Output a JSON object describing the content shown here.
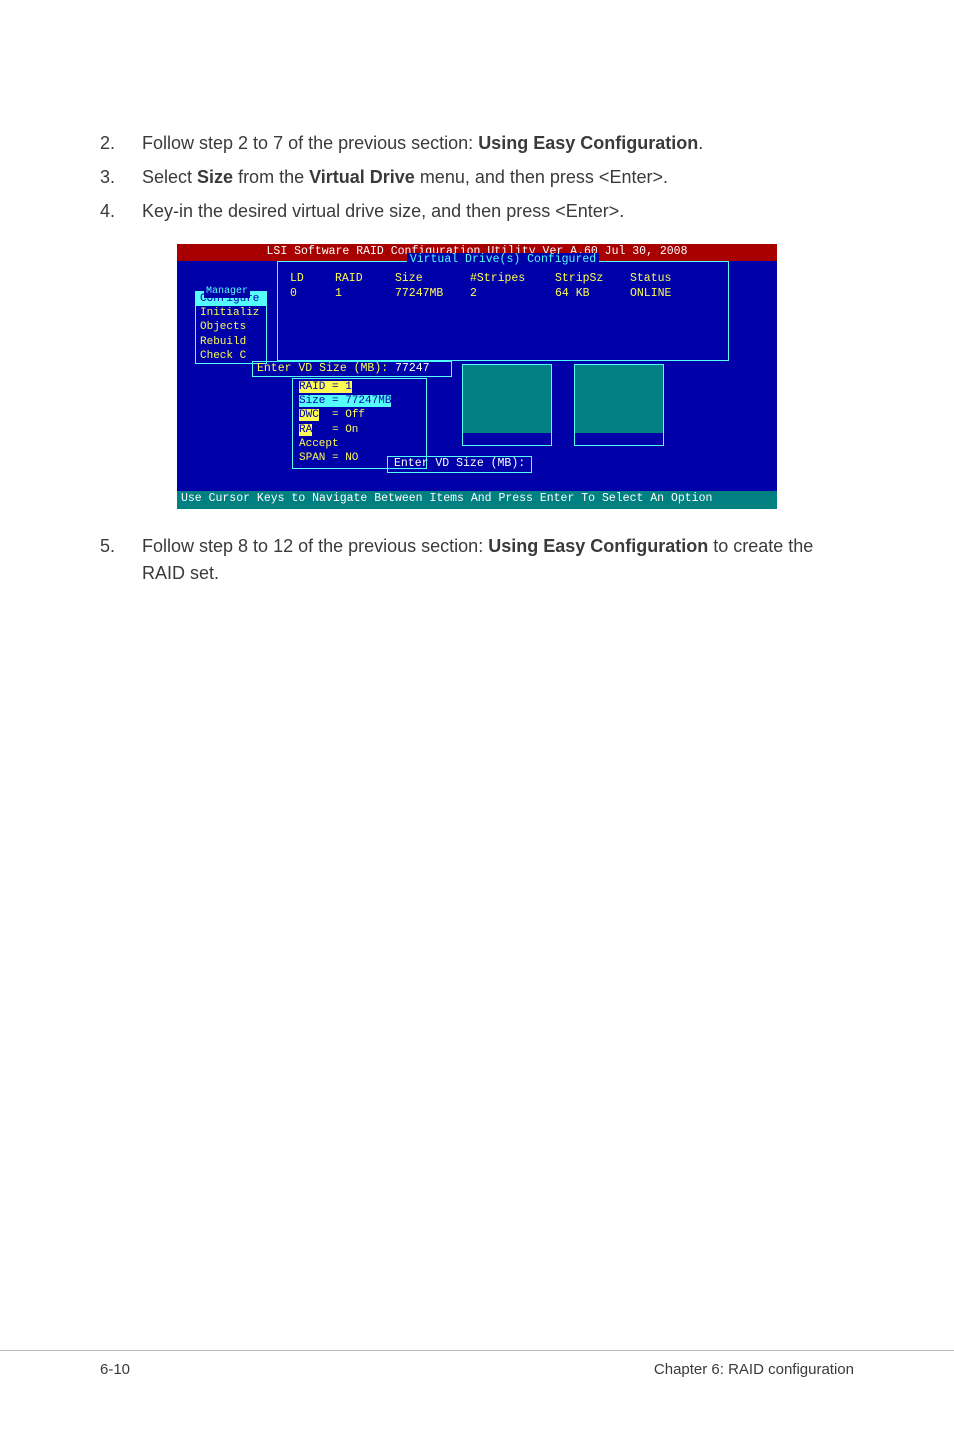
{
  "steps": {
    "s2": {
      "num": "2.",
      "pre": "Follow step 2 to 7 of the previous section: ",
      "bold": "Using Easy Configuration",
      "post": "."
    },
    "s3": {
      "num": "3.",
      "pre": "Select ",
      "bold1": "Size",
      "mid": " from the ",
      "bold2": "Virtual Drive",
      "post": " menu, and then press <Enter>."
    },
    "s4": {
      "num": "4.",
      "text": "Key-in the desired virtual drive size, and then press <Enter>."
    },
    "s5": {
      "num": "5.",
      "pre": "Follow step 8 to 12 of the previous section: ",
      "bold": "Using Easy Configuration",
      "post": " to create the RAID set."
    }
  },
  "bios": {
    "topbar": "LSI Software RAID Configuration Utility Ver A.60 Jul 30, 2008",
    "vd_title": "Virtual Drive(s) Configured",
    "headers": {
      "c1": "LD",
      "c2": "RAID",
      "c3": "Size",
      "c4": "#Stripes",
      "c5": "StripSz",
      "c6": "Status"
    },
    "row": {
      "c1": "0",
      "c2": "1",
      "c3": "77247MB",
      "c4": "2",
      "c5": "64 KB",
      "c6": "ONLINE"
    },
    "menu_title": "Manager",
    "menu": [
      "Configure",
      "Initializ",
      "Objects",
      "Rebuild",
      "Check C"
    ],
    "enter_label": "Enter VD Size (MB): ",
    "enter_value": "77247",
    "props": {
      "p1": "RAID = 1",
      "p2": "Size = 77247MB",
      "p3k": "DWC",
      "p3v": "  = Off",
      "p4k": "RA",
      "p4v": "   = On",
      "p5": "Accept",
      "p6": "SPAN = NO"
    },
    "prompt": "Enter VD Size (MB):",
    "footer": "Use Cursor Keys to Navigate Between Items And Press Enter To Select An Option"
  },
  "page_footer": {
    "left": "6-10",
    "right": "Chapter 6: RAID configuration"
  }
}
